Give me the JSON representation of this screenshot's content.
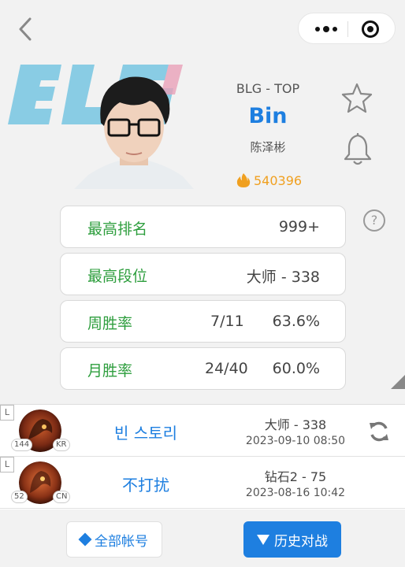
{
  "header": {
    "back_icon": "chevron-left-icon",
    "more_icon": "more-dots-icon",
    "close_icon": "target-close-icon"
  },
  "team": {
    "logo_text": "BLG",
    "logo_color": "#7ec8e3"
  },
  "player": {
    "team_position": "BLG - TOP",
    "name": "Bin",
    "real_name": "陈泽彬",
    "heat": "540396",
    "heat_icon": "fire-icon"
  },
  "actions": {
    "favorite_icon": "star-icon",
    "subscribe_icon": "bell-icon",
    "help_label": "?"
  },
  "stats": [
    {
      "label": "最高排名",
      "v1": "",
      "v2": "999+"
    },
    {
      "label": "最高段位",
      "v1": "",
      "v2": "大师 - 338"
    },
    {
      "label": "周胜率",
      "v1": "7/11",
      "v2": "63.6%"
    },
    {
      "label": "月胜率",
      "v1": "24/40",
      "v2": "60.0%"
    }
  ],
  "accounts": [
    {
      "tag": "L",
      "level": "144",
      "region": "KR",
      "name": "빈 스토리",
      "rank": "大师 - 338",
      "time": "2023-09-10 08:50",
      "sync_icon": "refresh-icon"
    },
    {
      "tag": "L",
      "level": "52",
      "region": "CN",
      "name": "不打扰",
      "rank": "钻石2 - 75",
      "time": "2023-08-16 10:42"
    }
  ],
  "footer": {
    "all_accounts_label": "全部帐号",
    "history_label": "历史对战"
  },
  "colors": {
    "accent": "#1e7fe0",
    "stat_label": "#2e9e3e",
    "heat": "#f0a020"
  }
}
